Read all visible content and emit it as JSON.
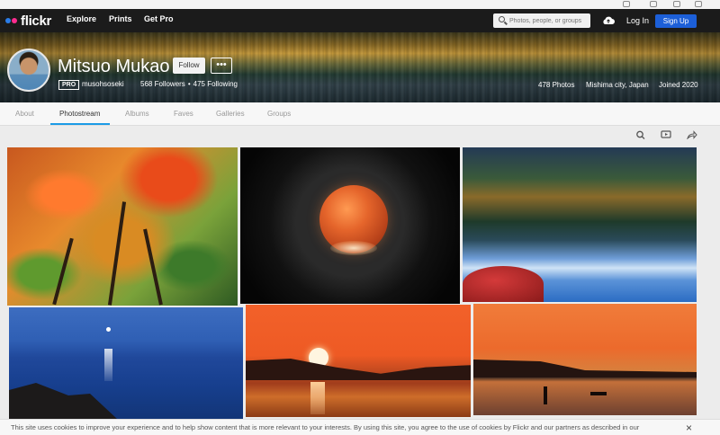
{
  "nav": {
    "logo": "flickr",
    "links": [
      "Explore",
      "Prints",
      "Get Pro"
    ],
    "search_placeholder": "Photos, people, or groups",
    "login": "Log In",
    "signup": "Sign Up"
  },
  "profile": {
    "name": "Mitsuo Mukao",
    "follow": "Follow",
    "more": "•••",
    "pro_badge": "PRO",
    "username": "musohsoseki",
    "followers": "568 Followers",
    "dot": "•",
    "following": "475 Following",
    "photos": "478 Photos",
    "location": "Mishima city, Japan",
    "joined": "Joined 2020"
  },
  "tabs": [
    "About",
    "Photostream",
    "Albums",
    "Faves",
    "Galleries",
    "Groups"
  ],
  "active_tab": "Photostream",
  "toolbar_icons": [
    "search-icon",
    "slideshow-icon",
    "share-icon"
  ],
  "cookie": {
    "text": "This site uses cookies to improve your experience and to help show content that is more relevant to your interests. By using this site, you agree to the use of cookies by Flickr and our partners as described in our",
    "close": "×"
  },
  "colors": {
    "nav_bg": "#1b1b1b",
    "signup_bg": "#1c5fd8",
    "tab_active_underline": "#1c9be6"
  }
}
